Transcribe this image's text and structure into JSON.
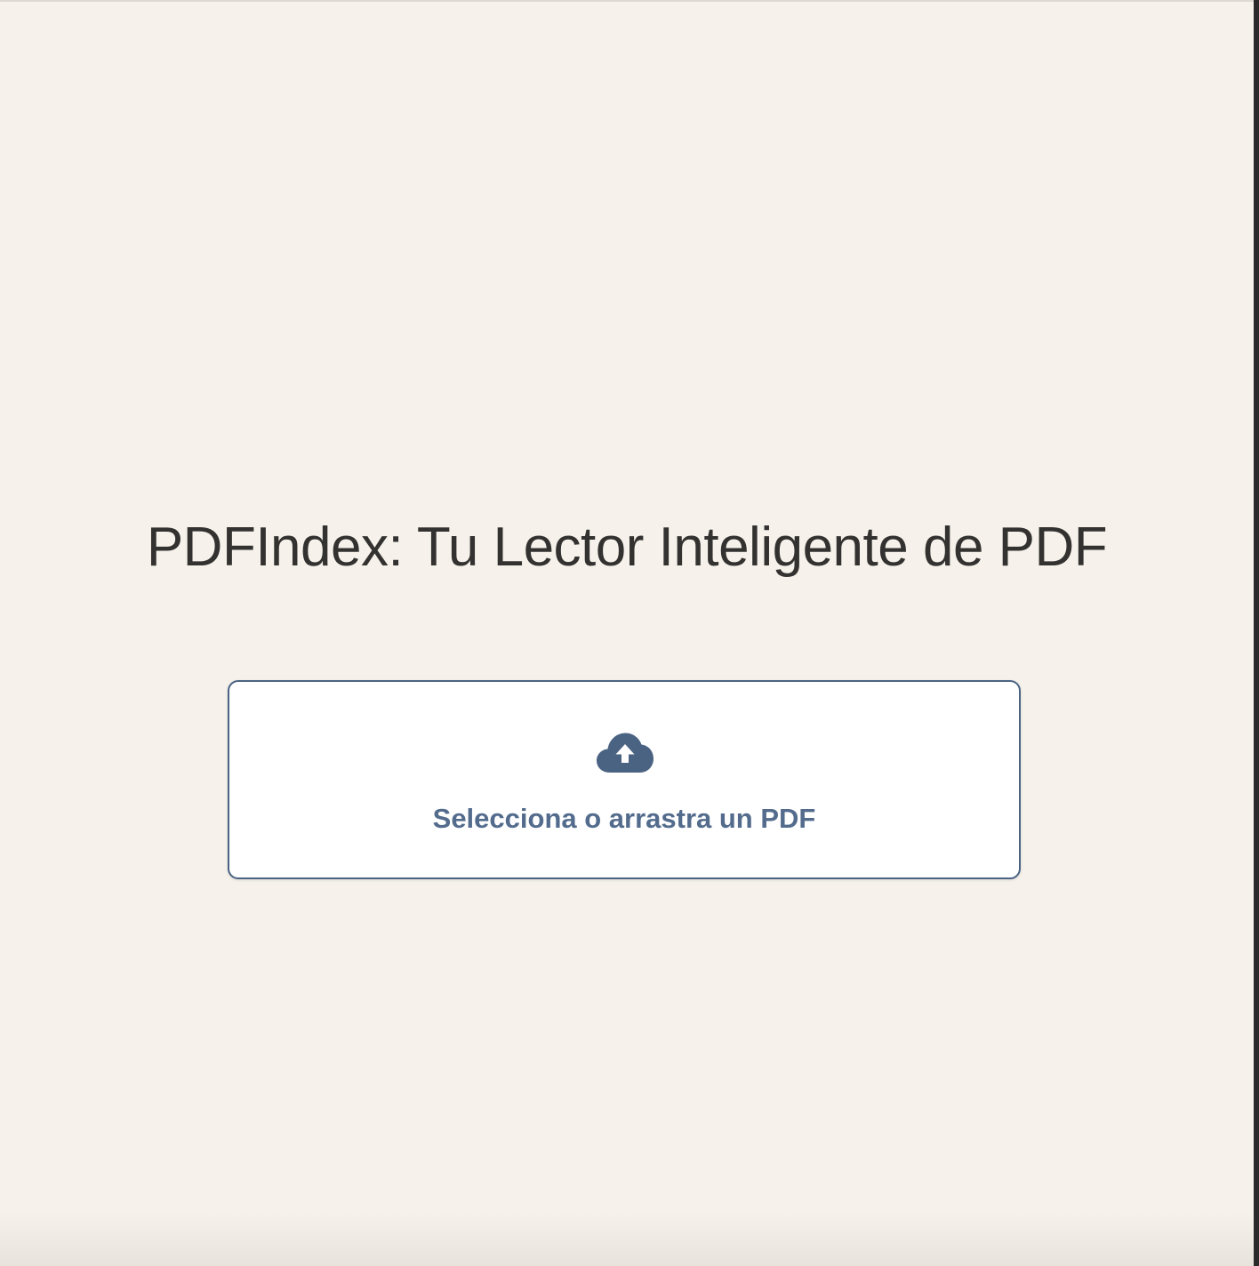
{
  "app": {
    "title": "PDFIndex: Tu Lector Inteligente de PDF"
  },
  "upload": {
    "label": "Selecciona o arrastra un PDF",
    "icon": "cloud-upload-icon"
  },
  "colors": {
    "background": "#f6f2eb",
    "accent": "#4b6383",
    "title_text": "#333230",
    "dropzone_background": "#ffffff"
  }
}
